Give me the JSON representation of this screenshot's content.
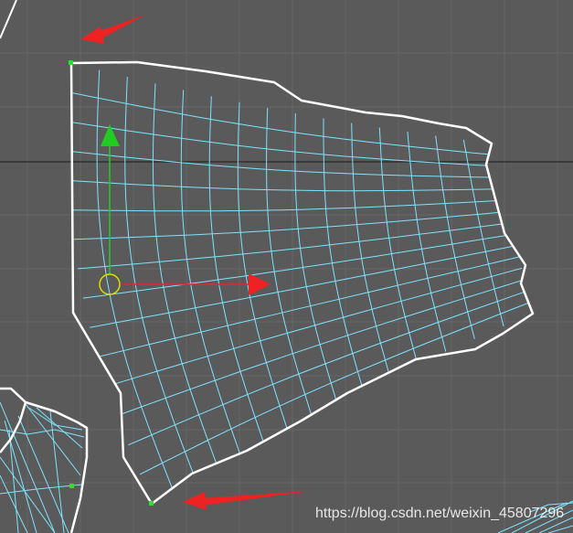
{
  "viewport": {
    "background_color": "#5a5a5a",
    "grid_color": "#666666",
    "axis_line_color": "#1a1a1a"
  },
  "uv_island": {
    "border_color": "#ffffff",
    "wire_color": "#7fe3ff",
    "selected_vertex_color": "#33dd33"
  },
  "gizmo": {
    "y_axis_color": "#22cc22",
    "x_axis_color": "#ee2222",
    "pivot_color": "#dddd00"
  },
  "annotation_arrow_color": "#ee2222",
  "watermark": {
    "text": "https://blog.csdn.net/weixin_45807296"
  }
}
